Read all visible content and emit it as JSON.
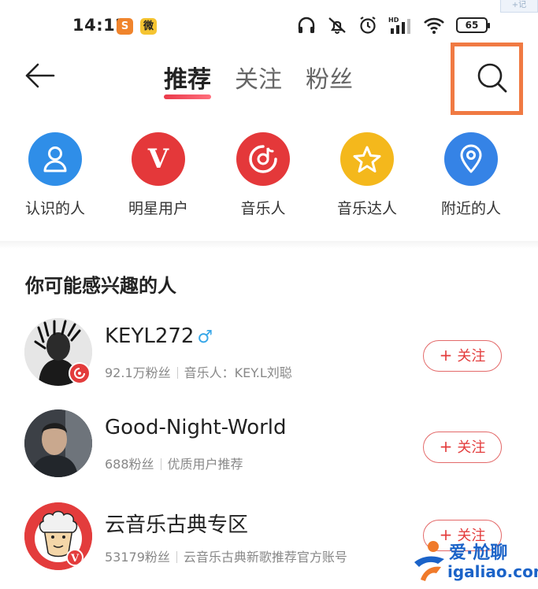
{
  "status_bar": {
    "time": "14:12",
    "app1": "S",
    "app2": "微",
    "battery": "65"
  },
  "corner_tab": "+记",
  "nav": {
    "tabs": [
      {
        "label": "推荐",
        "active": true
      },
      {
        "label": "关注",
        "active": false
      },
      {
        "label": "粉丝",
        "active": false
      }
    ]
  },
  "categories": [
    {
      "label": "认识的人",
      "color": "#2f8ee8",
      "icon": "person-icon"
    },
    {
      "label": "明星用户",
      "color": "#e4383a",
      "icon": "v-icon"
    },
    {
      "label": "音乐人",
      "color": "#e4383a",
      "icon": "music-disc-icon"
    },
    {
      "label": "音乐达人",
      "color": "#f4b81c",
      "icon": "star-icon"
    },
    {
      "label": "附近的人",
      "color": "#3583e6",
      "icon": "location-icon"
    }
  ],
  "section_title": "你可能感兴趣的人",
  "users": [
    {
      "name": "KEYL272",
      "gender": "♂",
      "fans": "92.1万粉丝",
      "desc": "音乐人：KEY.L刘聪",
      "follow": "关注"
    },
    {
      "name": "Good-Night-World",
      "gender": "",
      "fans": "688粉丝",
      "desc": "优质用户推荐",
      "follow": "关注"
    },
    {
      "name": "云音乐古典专区",
      "gender": "",
      "fans": "53179粉丝",
      "desc": "云音乐古典新歌推荐官方账号",
      "follow": "关注"
    }
  ],
  "watermark": {
    "text": "爱·尬聊",
    "url": "igaliao.com"
  }
}
